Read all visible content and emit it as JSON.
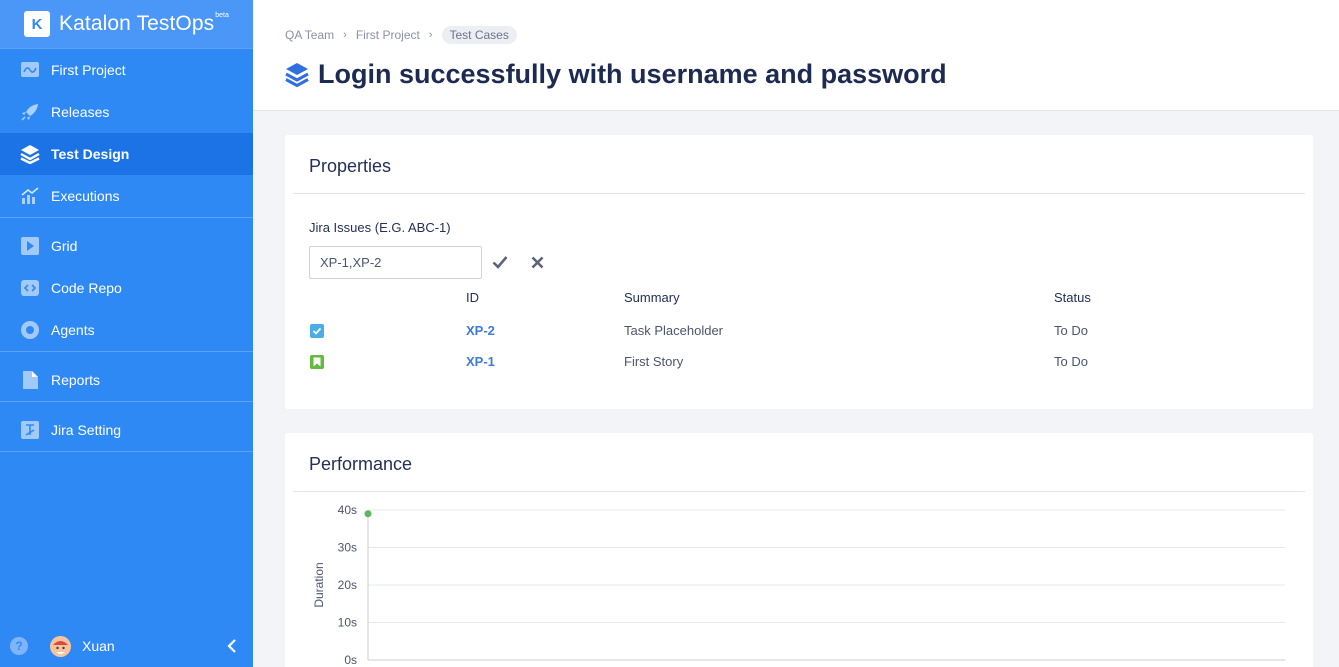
{
  "app": {
    "name": "Katalon TestOps",
    "badge": "beta",
    "logo_letter": "K"
  },
  "sidebar": {
    "groups": [
      [
        {
          "label": "First Project",
          "icon": "project-icon"
        },
        {
          "label": "Releases",
          "icon": "rocket-icon"
        },
        {
          "label": "Test Design",
          "icon": "layers-icon",
          "active": true
        },
        {
          "label": "Executions",
          "icon": "chart-icon"
        }
      ],
      [
        {
          "label": "Grid",
          "icon": "play-icon"
        },
        {
          "label": "Code Repo",
          "icon": "code-icon"
        },
        {
          "label": "Agents",
          "icon": "agent-icon"
        }
      ],
      [
        {
          "label": "Reports",
          "icon": "file-icon"
        }
      ],
      [
        {
          "label": "Jira Setting",
          "icon": "jira-icon"
        }
      ]
    ],
    "footer": {
      "help": "?",
      "user": "Xuan"
    }
  },
  "breadcrumb": [
    "QA Team",
    "First Project",
    "Test Cases"
  ],
  "page": {
    "title": "Login successfully with username and password"
  },
  "properties": {
    "title": "Properties",
    "jira_label": "Jira Issues (E.G. ABC-1)",
    "jira_value": "XP-1,XP-2",
    "columns": {
      "id": "ID",
      "summary": "Summary",
      "status": "Status"
    },
    "issues": [
      {
        "type": "task",
        "id": "XP-2",
        "summary": "Task Placeholder",
        "status": "To Do"
      },
      {
        "type": "story",
        "id": "XP-1",
        "summary": "First Story",
        "status": "To Do"
      }
    ]
  },
  "performance": {
    "title": "Performance",
    "colors": {
      "point": "#5cb85c",
      "grid": "#e6e8ee",
      "axis": "#c8ccd6"
    }
  },
  "chart_data": {
    "type": "scatter",
    "ylabel": "Duration",
    "ylim": [
      0,
      40
    ],
    "yticks": [
      "0s",
      "10s",
      "20s",
      "30s",
      "40s"
    ],
    "points": [
      {
        "y": 39
      }
    ],
    "grid": true
  }
}
